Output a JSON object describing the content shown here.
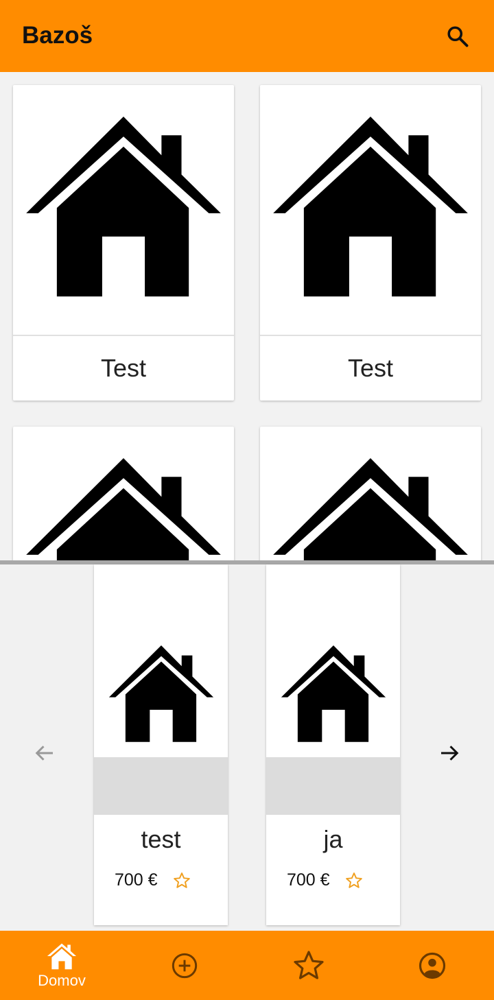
{
  "app": {
    "title": "Bazoš"
  },
  "icons": {
    "search": "search-icon",
    "house": "house-icon",
    "back": "arrow-back-icon",
    "forward": "arrow-forward-icon",
    "star": "star-outline-icon",
    "add": "add-circle-icon",
    "favorites": "star-icon",
    "profile": "account-circle-icon"
  },
  "colors": {
    "accent": "#ff8c00",
    "star": "#f0a020"
  },
  "grid": {
    "cards": [
      {
        "label": "Test"
      },
      {
        "label": "Test"
      },
      {
        "label": ""
      },
      {
        "label": ""
      }
    ]
  },
  "carousel": {
    "items": [
      {
        "title": "test",
        "price": "700 €"
      },
      {
        "title": "ja",
        "price": "700 €"
      }
    ]
  },
  "bottom_nav": {
    "home_label": "Domov"
  }
}
